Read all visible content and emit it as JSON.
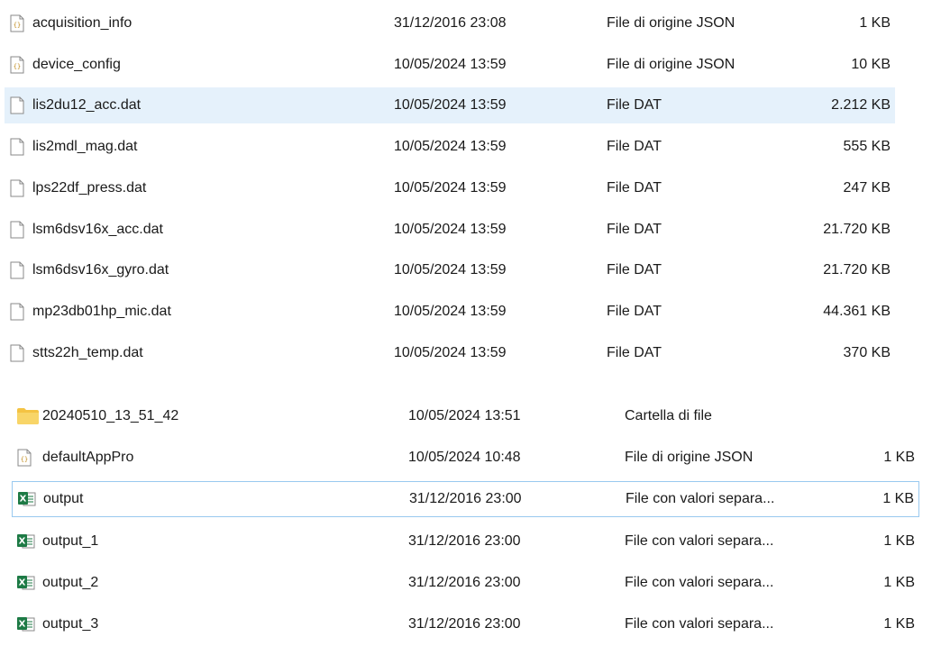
{
  "group1": {
    "rows": [
      {
        "name": "acquisition_info",
        "date": "31/12/2016 23:08",
        "type": "File di origine JSON",
        "size": "1 KB",
        "icon": "json-file-icon"
      },
      {
        "name": "device_config",
        "date": "10/05/2024 13:59",
        "type": "File di origine JSON",
        "size": "10 KB",
        "icon": "json-file-icon"
      },
      {
        "name": "lis2du12_acc.dat",
        "date": "10/05/2024 13:59",
        "type": "File DAT",
        "size": "2.212 KB",
        "icon": "generic-file-icon",
        "selected": true
      },
      {
        "name": "lis2mdl_mag.dat",
        "date": "10/05/2024 13:59",
        "type": "File DAT",
        "size": "555 KB",
        "icon": "generic-file-icon"
      },
      {
        "name": "lps22df_press.dat",
        "date": "10/05/2024 13:59",
        "type": "File DAT",
        "size": "247 KB",
        "icon": "generic-file-icon"
      },
      {
        "name": "lsm6dsv16x_acc.dat",
        "date": "10/05/2024 13:59",
        "type": "File DAT",
        "size": "21.720 KB",
        "icon": "generic-file-icon"
      },
      {
        "name": "lsm6dsv16x_gyro.dat",
        "date": "10/05/2024 13:59",
        "type": "File DAT",
        "size": "21.720 KB",
        "icon": "generic-file-icon"
      },
      {
        "name": "mp23db01hp_mic.dat",
        "date": "10/05/2024 13:59",
        "type": "File DAT",
        "size": "44.361 KB",
        "icon": "generic-file-icon"
      },
      {
        "name": "stts22h_temp.dat",
        "date": "10/05/2024 13:59",
        "type": "File DAT",
        "size": "370 KB",
        "icon": "generic-file-icon"
      }
    ]
  },
  "group2": {
    "rows": [
      {
        "name": "20240510_13_51_42",
        "date": "10/05/2024 13:51",
        "type": "Cartella di file",
        "size": "",
        "icon": "folder-icon"
      },
      {
        "name": "defaultAppPro",
        "date": "10/05/2024 10:48",
        "type": "File di origine JSON",
        "size": "1 KB",
        "icon": "json-file-icon"
      },
      {
        "name": "output",
        "date": "31/12/2016 23:00",
        "type": "File con valori separa...",
        "size": "1 KB",
        "icon": "excel-csv-icon",
        "focused": true
      },
      {
        "name": "output_1",
        "date": "31/12/2016 23:00",
        "type": "File con valori separa...",
        "size": "1 KB",
        "icon": "excel-csv-icon"
      },
      {
        "name": "output_2",
        "date": "31/12/2016 23:00",
        "type": "File con valori separa...",
        "size": "1 KB",
        "icon": "excel-csv-icon"
      },
      {
        "name": "output_3",
        "date": "31/12/2016 23:00",
        "type": "File con valori separa...",
        "size": "1 KB",
        "icon": "excel-csv-icon"
      }
    ]
  },
  "colors": {
    "selected_bg": "#e5f1fb",
    "focus_border": "#99c9ef",
    "folder": "#f4c343",
    "excel": "#1d7a45"
  }
}
